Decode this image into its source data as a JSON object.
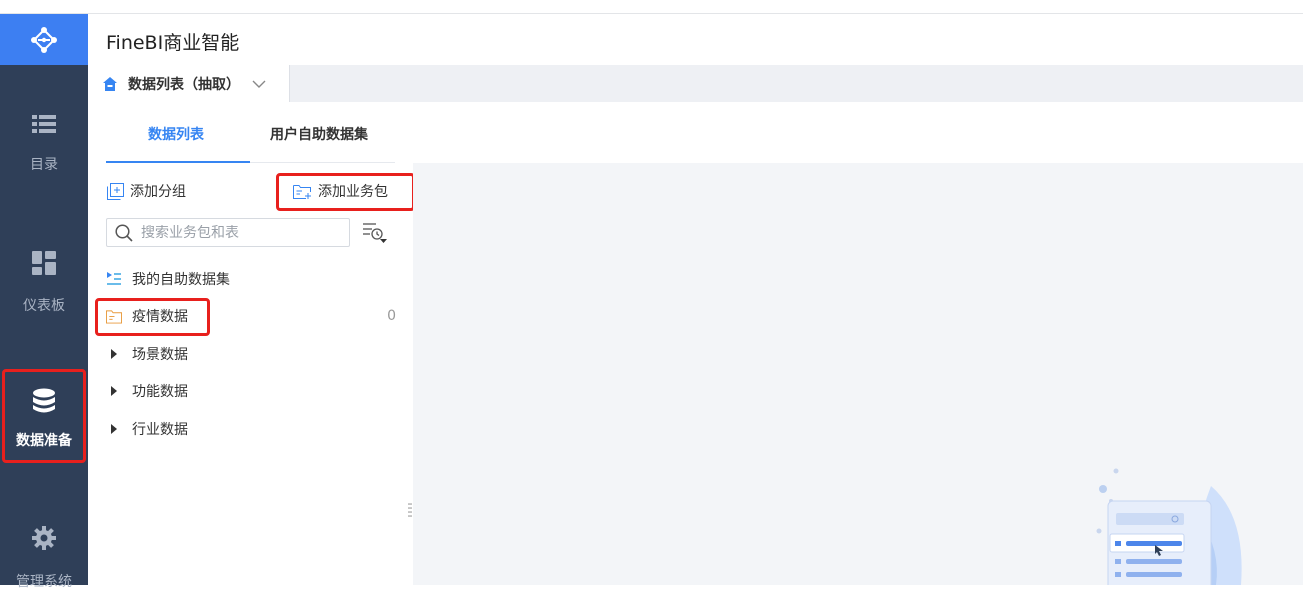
{
  "app": {
    "title": "FineBI商业智能"
  },
  "sidebar": {
    "items": [
      {
        "label": "目录",
        "icon": "list-icon"
      },
      {
        "label": "仪表板",
        "icon": "dashboard-icon"
      },
      {
        "label": "数据准备",
        "icon": "database-icon",
        "active": true
      },
      {
        "label": "管理系统",
        "icon": "gear-icon"
      }
    ]
  },
  "package_tab": {
    "label": "数据列表（抽取）"
  },
  "sub_tabs": [
    {
      "label": "数据列表",
      "active": true
    },
    {
      "label": "用户自助数据集",
      "active": false
    }
  ],
  "actions": {
    "add_group": "添加分组",
    "add_package": "添加业务包"
  },
  "search": {
    "placeholder": "搜索业务包和表"
  },
  "tree": [
    {
      "label": "我的自助数据集",
      "icon": "self-dataset-icon"
    },
    {
      "label": "疫情数据",
      "icon": "folder-icon",
      "count": "0"
    },
    {
      "label": "场景数据",
      "icon": "caret-right-icon"
    },
    {
      "label": "功能数据",
      "icon": "caret-right-icon"
    },
    {
      "label": "行业数据",
      "icon": "caret-right-icon"
    }
  ],
  "colors": {
    "accent": "#3685f2",
    "sidebar": "#2f3f58",
    "logo": "#3d7ff2",
    "highlight": "#e8201d"
  }
}
